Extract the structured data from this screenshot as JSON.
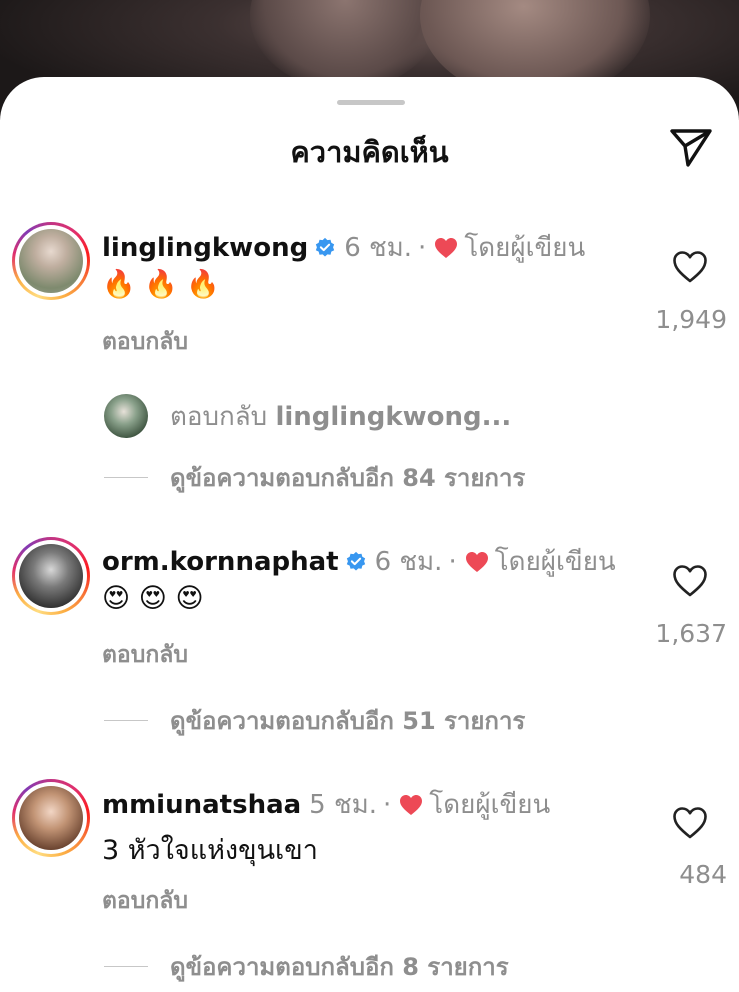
{
  "sheet": {
    "title": "ความคิดเห็น"
  },
  "comments": [
    {
      "username": "linglingkwong",
      "verified": true,
      "time": "6 ชม.",
      "separator": "·",
      "liked_by_author": "โดยผู้เขียน",
      "text": "🔥 🔥 🔥",
      "reply_label": "ตอบกลับ",
      "like_count": "1,949",
      "reply_preview": {
        "prefix": "ตอบกลับ",
        "username": "linglingkwong..."
      },
      "view_more": "ดูข้อความตอบกลับอีก 84 รายการ"
    },
    {
      "username": "orm.kornnaphat",
      "verified": true,
      "time": "6 ชม.",
      "separator": "·",
      "liked_by_author": "โดยผู้เขียน",
      "text": "😍 😍 😍",
      "reply_label": "ตอบกลับ",
      "like_count": "1,637",
      "view_more": "ดูข้อความตอบกลับอีก 51 รายการ"
    },
    {
      "username": "mmiunatshaa",
      "verified": false,
      "time": "5 ชม.",
      "separator": "·",
      "liked_by_author": "โดยผู้เขียน",
      "text": "3 หัวใจแห่งขุนเขา",
      "reply_label": "ตอบกลับ",
      "like_count": "484",
      "view_more": "ดูข้อความตอบกลับอีก 8 รายการ"
    }
  ],
  "colors": {
    "accent_red": "#ed4956",
    "verified_blue": "#3897f0",
    "muted": "#8e8e8e"
  },
  "icons": {
    "send": "paper-plane-icon",
    "like": "heart-outline-icon",
    "author_like": "heart-filled-icon",
    "verified": "verified-badge-icon"
  }
}
